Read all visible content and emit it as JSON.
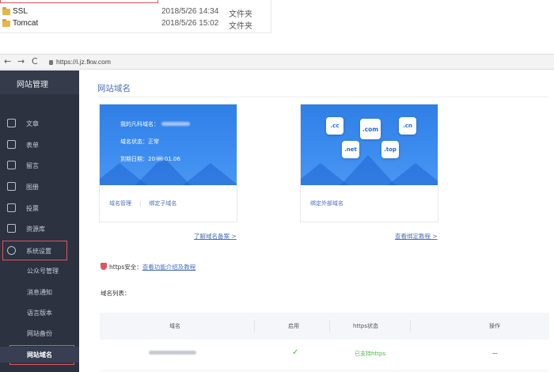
{
  "explorer": {
    "rows": [
      {
        "name": "SSL",
        "date": "2018/5/26 14:34",
        "type": "文件夹"
      },
      {
        "name": "Tomcat",
        "date": "2018/5/26 15:02",
        "type": "文件夹"
      }
    ]
  },
  "browser": {
    "back": "←",
    "forward": "→",
    "reload": "C",
    "url": "https://i.jz.fkw.com"
  },
  "sidebar": {
    "title": "网站管理",
    "items": [
      {
        "label": "文章",
        "icon": "article-icon"
      },
      {
        "label": "表单",
        "icon": "form-icon"
      },
      {
        "label": "留言",
        "icon": "message-icon"
      },
      {
        "label": "图册",
        "icon": "gallery-icon"
      },
      {
        "label": "投票",
        "icon": "vote-icon"
      },
      {
        "label": "资源库",
        "icon": "resource-icon"
      },
      {
        "label": "系统设置",
        "icon": "settings-icon"
      }
    ],
    "sub_items": [
      {
        "label": "公众号管理"
      },
      {
        "label": "消息通知"
      },
      {
        "label": "语言版本"
      },
      {
        "label": "网站备份"
      },
      {
        "label": "网站域名"
      }
    ]
  },
  "main": {
    "title": "网站域名",
    "card1": {
      "line1": "我的凡科域名：",
      "line2": "域名状态：正常",
      "line3_prefix": "到期日期：20",
      "line3_suffix": "01.06",
      "link1": "域名管理",
      "link2": "绑定子域名"
    },
    "card2": {
      "tlds": [
        ".cc",
        ".com",
        ".cn",
        ".net",
        ".top"
      ],
      "link": "绑定外部域名"
    },
    "learn_link": "了解域名备案 >",
    "bind_tutorial_link": "查看绑定教程 >",
    "https_label": "https安全：",
    "https_link": "查看功能介绍及教程",
    "list_label": "域名列表：",
    "table": {
      "headers": [
        "域名",
        "启用",
        "https状态",
        "操作"
      ],
      "row": {
        "enabled": "✓",
        "https": "已支持https",
        "action": "—"
      }
    }
  },
  "colors": {
    "sidebar_bg": "#2c3240",
    "accent": "#4a6fbf",
    "banner_blue": "#2f7fe6",
    "highlight_red": "#e0555f",
    "ok_green": "#52b34a"
  }
}
